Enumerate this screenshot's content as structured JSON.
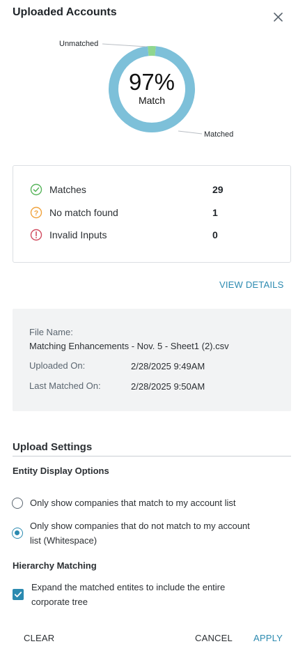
{
  "header": {
    "title": "Uploaded Accounts"
  },
  "chart_data": {
    "type": "pie",
    "labels": [
      "Unmatched",
      "Matched"
    ],
    "values": [
      3,
      97
    ],
    "center_value": "97%",
    "center_label": "Match",
    "colors": {
      "Matched": "#7dc0d9",
      "Unmatched": "#8fd68f"
    }
  },
  "stats": [
    {
      "icon": "check-circle-icon",
      "label": "Matches",
      "value": "29",
      "color": "#56b45a"
    },
    {
      "icon": "question-circle-icon",
      "label": "No match found",
      "value": "1",
      "color": "#f0a23c"
    },
    {
      "icon": "alert-circle-icon",
      "label": "Invalid Inputs",
      "value": "0",
      "color": "#d14b5f"
    }
  ],
  "view_details_label": "VIEW DETAILS",
  "file_info": {
    "file_name_label": "File Name:",
    "file_name": "Matching Enhancements - Nov. 5 - Sheet1 (2).csv",
    "uploaded_label": "Uploaded On:",
    "uploaded_value": "2/28/2025 9:49AM",
    "matched_label": "Last Matched On:",
    "matched_value": "2/28/2025 9:50AM"
  },
  "settings": {
    "title": "Upload Settings",
    "entity_title": "Entity Display Options",
    "option_1": "Only show companies that match to my account list",
    "option_2_line1": "Only show companies that do not match to my account",
    "option_2_line2": "list (Whitespace)",
    "selected_option": 2,
    "hierarchy_title": "Hierarchy Matching",
    "hierarchy_line1": "Expand the matched entites to include the entire",
    "hierarchy_line2": "corporate tree",
    "hierarchy_checked": true
  },
  "footer": {
    "clear": "CLEAR",
    "cancel": "CANCEL",
    "apply": "APPLY"
  },
  "accent_color": "#2b8ab0"
}
